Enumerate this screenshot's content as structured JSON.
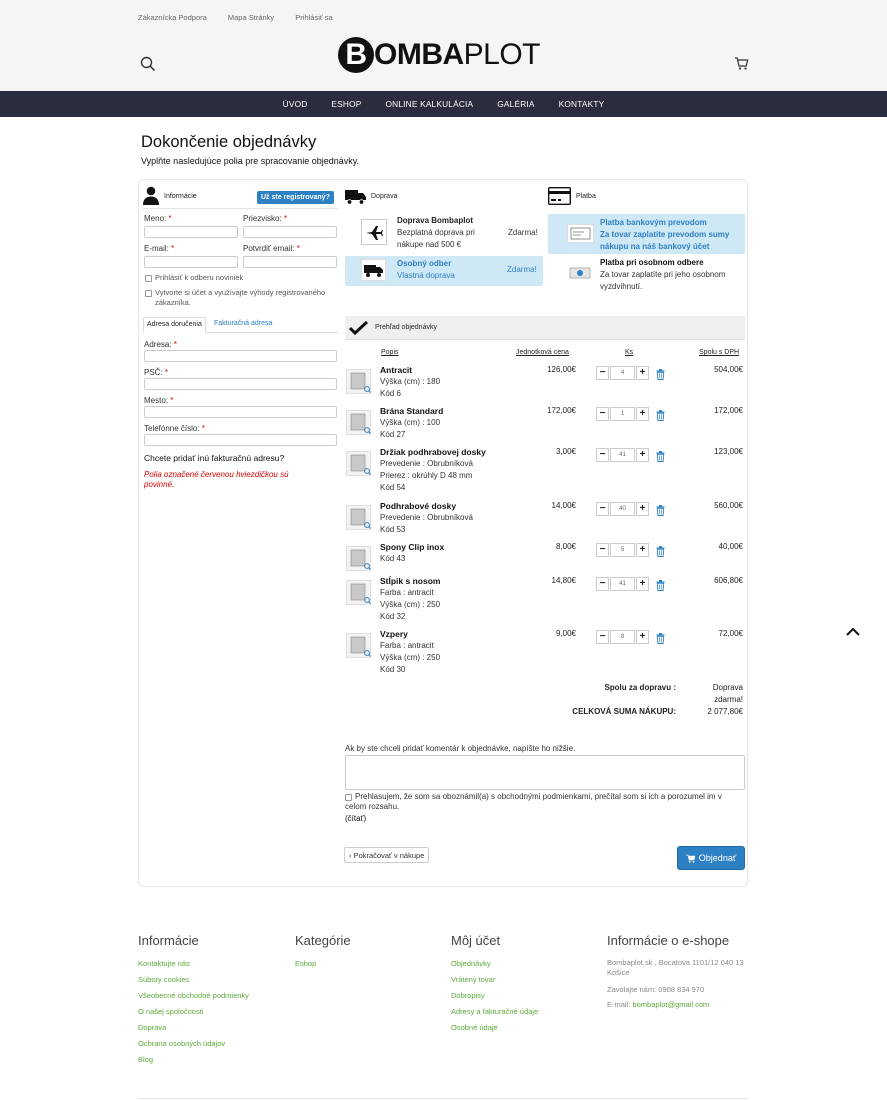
{
  "top_links": [
    "Zákaznícka Podpora",
    "Mapa Stránky",
    "Prihlásiť sa"
  ],
  "logo": {
    "letter": "B",
    "mid": "OMBA",
    "rest": "PLOT"
  },
  "nav": [
    "ÚVOD",
    "ESHOP",
    "ONLINE KALKULÁCIA",
    "GALÉRIA",
    "KONTAKTY"
  ],
  "page_title": "Dokončenie objednávky",
  "page_subtitle": "Vyplňte nasledujúce polia pre spracovanie objednávky.",
  "info": {
    "title": "Informácie",
    "registered_btn": "Už ste registrovaný?",
    "name_label": "Meno:",
    "surname_label": "Priezvisko:",
    "email_label": "E-mail:",
    "email_confirm_label": "Potvrdiť email:",
    "newsletter": "Prihlásiť k odberu noviniek",
    "create_account": "Vytvorte si účet a využívajte výhody registrovaného zákazníka.",
    "tab_delivery": "Adresa doručenia",
    "tab_invoice": "Fakturačná adresa",
    "address_label": "Adresa:",
    "zip_label": "PSČ:",
    "city_label": "Mesto:",
    "phone_label": "Telefónne číslo:",
    "other_invoice": "Chcete pridať inú fakturačnú adresu?",
    "required_note": "Polia označené červenou hviezdičkou sú povinné.",
    "req_mark": "*"
  },
  "shipping": {
    "title": "Doprava",
    "options": [
      {
        "name": "Doprava Bombaplot",
        "desc": "Bezplatná doprava pri nákupe nad 500 €",
        "price": "Zdarma!"
      },
      {
        "name": "Osobný odber",
        "desc": "Vlastná doprava",
        "price": "Zdarma!"
      }
    ]
  },
  "payment": {
    "title": "Platba",
    "options": [
      {
        "name": "Platba bankovým prevodom",
        "desc": "Za tovar zaplatíte prevodom sumy nákupu na náš bankový účet"
      },
      {
        "name": "Platba pri osobnom odbere",
        "desc": "Za tovar zaplatíte pri jeho osobnom vyzdvihnutí."
      }
    ]
  },
  "overview": {
    "title": "Prehľad objednávky",
    "headers": [
      "Popis",
      "Jednotková cena",
      "Ks",
      "Spolu s DPH"
    ],
    "items": [
      {
        "name": "Antracit",
        "desc": [
          "Výška (cm) : 180",
          "Kód 6"
        ],
        "unit": "126,00€",
        "qty": "4",
        "total": "504,00€"
      },
      {
        "name": "Brána Standard",
        "desc": [
          "Výška (cm) : 100",
          "Kód 27"
        ],
        "unit": "172,00€",
        "qty": "1",
        "total": "172,00€"
      },
      {
        "name": "Držiak podhrabovej dosky",
        "desc": [
          "Prevedenie : Obrubníková",
          "Prierez : okrúhly D 48 mm",
          "Kód 54"
        ],
        "unit": "3,00€",
        "qty": "41",
        "total": "123,00€"
      },
      {
        "name": "Podhrabové dosky",
        "desc": [
          "Prevedenie : Obrubníková",
          "Kód 53"
        ],
        "unit": "14,00€",
        "qty": "40",
        "total": "560,00€"
      },
      {
        "name": "Spony Clip inox",
        "desc": [
          "Kód 43"
        ],
        "unit": "8,00€",
        "qty": "5",
        "total": "40,00€"
      },
      {
        "name": "Stĺpik s nosom",
        "desc": [
          "Farba : antracit",
          "Výška (cm) : 250",
          "Kód 32"
        ],
        "unit": "14,80€",
        "qty": "41",
        "total": "606,80€"
      },
      {
        "name": "Vzpery",
        "desc": [
          "Farba : antracit",
          "Výška (cm) : 250",
          "Kód 30"
        ],
        "unit": "9,00€",
        "qty": "8",
        "total": "72,00€"
      }
    ],
    "shipping_label": "Spolu za dopravu :",
    "shipping_value_1": "Doprava",
    "shipping_value_2": "zdarma!",
    "total_label": "CELKOVÁ SUMA NÁKUPU:",
    "total_value": "2 077,80€"
  },
  "comment_label": "Ak by ste chceli pridať komentár k objednávke, napíšte ho nižšie.",
  "terms_text": "Prehlasujem, že som sa oboznámil(a) s obchodnými podmienkami, prečítal som si ich a porozumel im v celom rozsahu.",
  "terms_link": "(čítať)",
  "back_btn": "Pokračovať v nákupe",
  "order_btn": "Objednať",
  "footer": {
    "col1": {
      "title": "Informácie",
      "links": [
        "Kontaktujte nás",
        "Súbory cookies",
        "Všeobecné obchodné podmienky",
        "O našej spoločnosti",
        "Doprava",
        "Ochrana osobných údajov",
        "Blog"
      ]
    },
    "col2": {
      "title": "Kategórie",
      "links": [
        "Eshop"
      ]
    },
    "col3": {
      "title": "Môj účet",
      "links": [
        "Objednávky",
        "Vrátený tovar",
        "Dobropisy",
        "Adresy a fakturačné údaje",
        "Osobné údaje"
      ]
    },
    "col4": {
      "title": "Informácie o e-shope",
      "address": "Bombaplot.sk , Bocatova 1101/12 040 13 Košice",
      "phone": "Zavolajte nám: 0908 834 970",
      "email_label": "E-mail:",
      "email": "bombaplot@gmail.com"
    }
  },
  "colors": {
    "accent": "#2d80c4",
    "nav_bg": "#2b2c3d",
    "footer_link": "#5fa83a",
    "selected_bg": "#cfe8f5"
  }
}
